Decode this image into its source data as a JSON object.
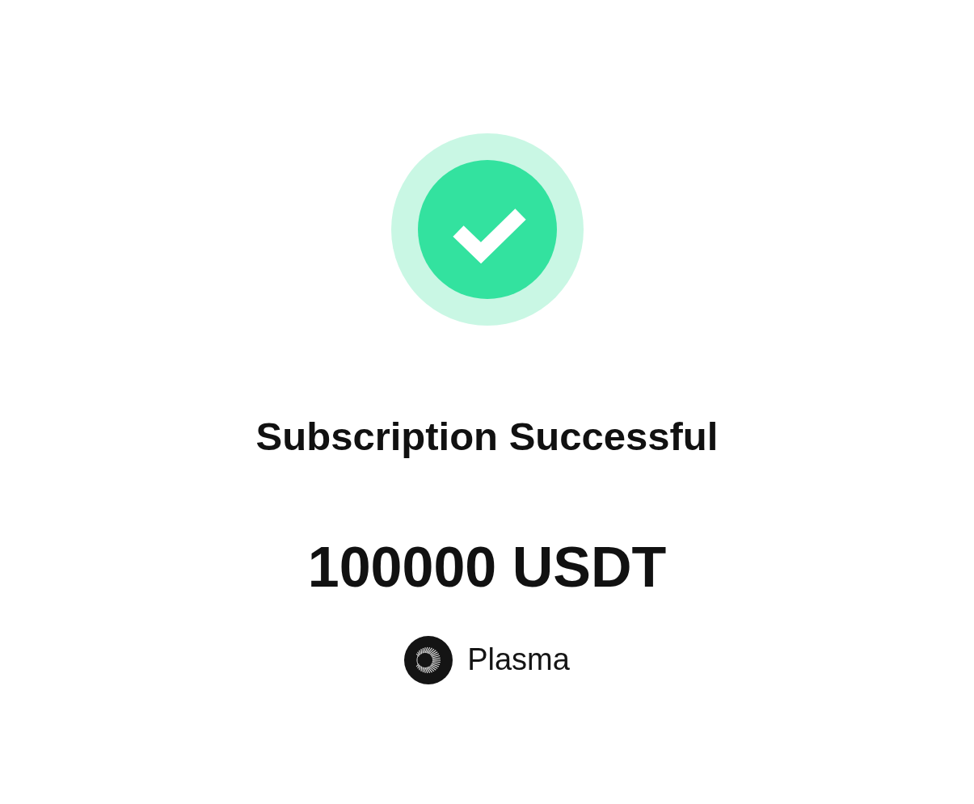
{
  "status": {
    "kind": "success",
    "title": "Subscription Successful"
  },
  "amount": "100000 USDT",
  "network": {
    "name": "Plasma"
  }
}
